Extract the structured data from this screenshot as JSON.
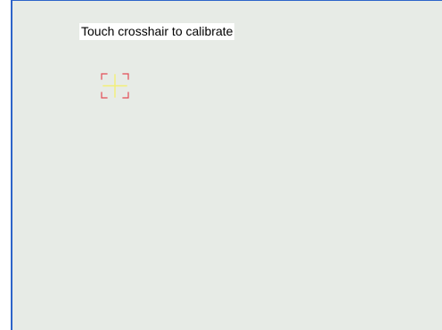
{
  "screen": {
    "background": "#e7ebe6",
    "frame_border": "#2e64c9"
  },
  "calibration": {
    "instruction": "Touch crosshair to calibrate",
    "target": {
      "icon": "calibration-crosshair-icon",
      "bracket_color": "#e34b55",
      "crosshair_color": "#f3ef75"
    }
  }
}
